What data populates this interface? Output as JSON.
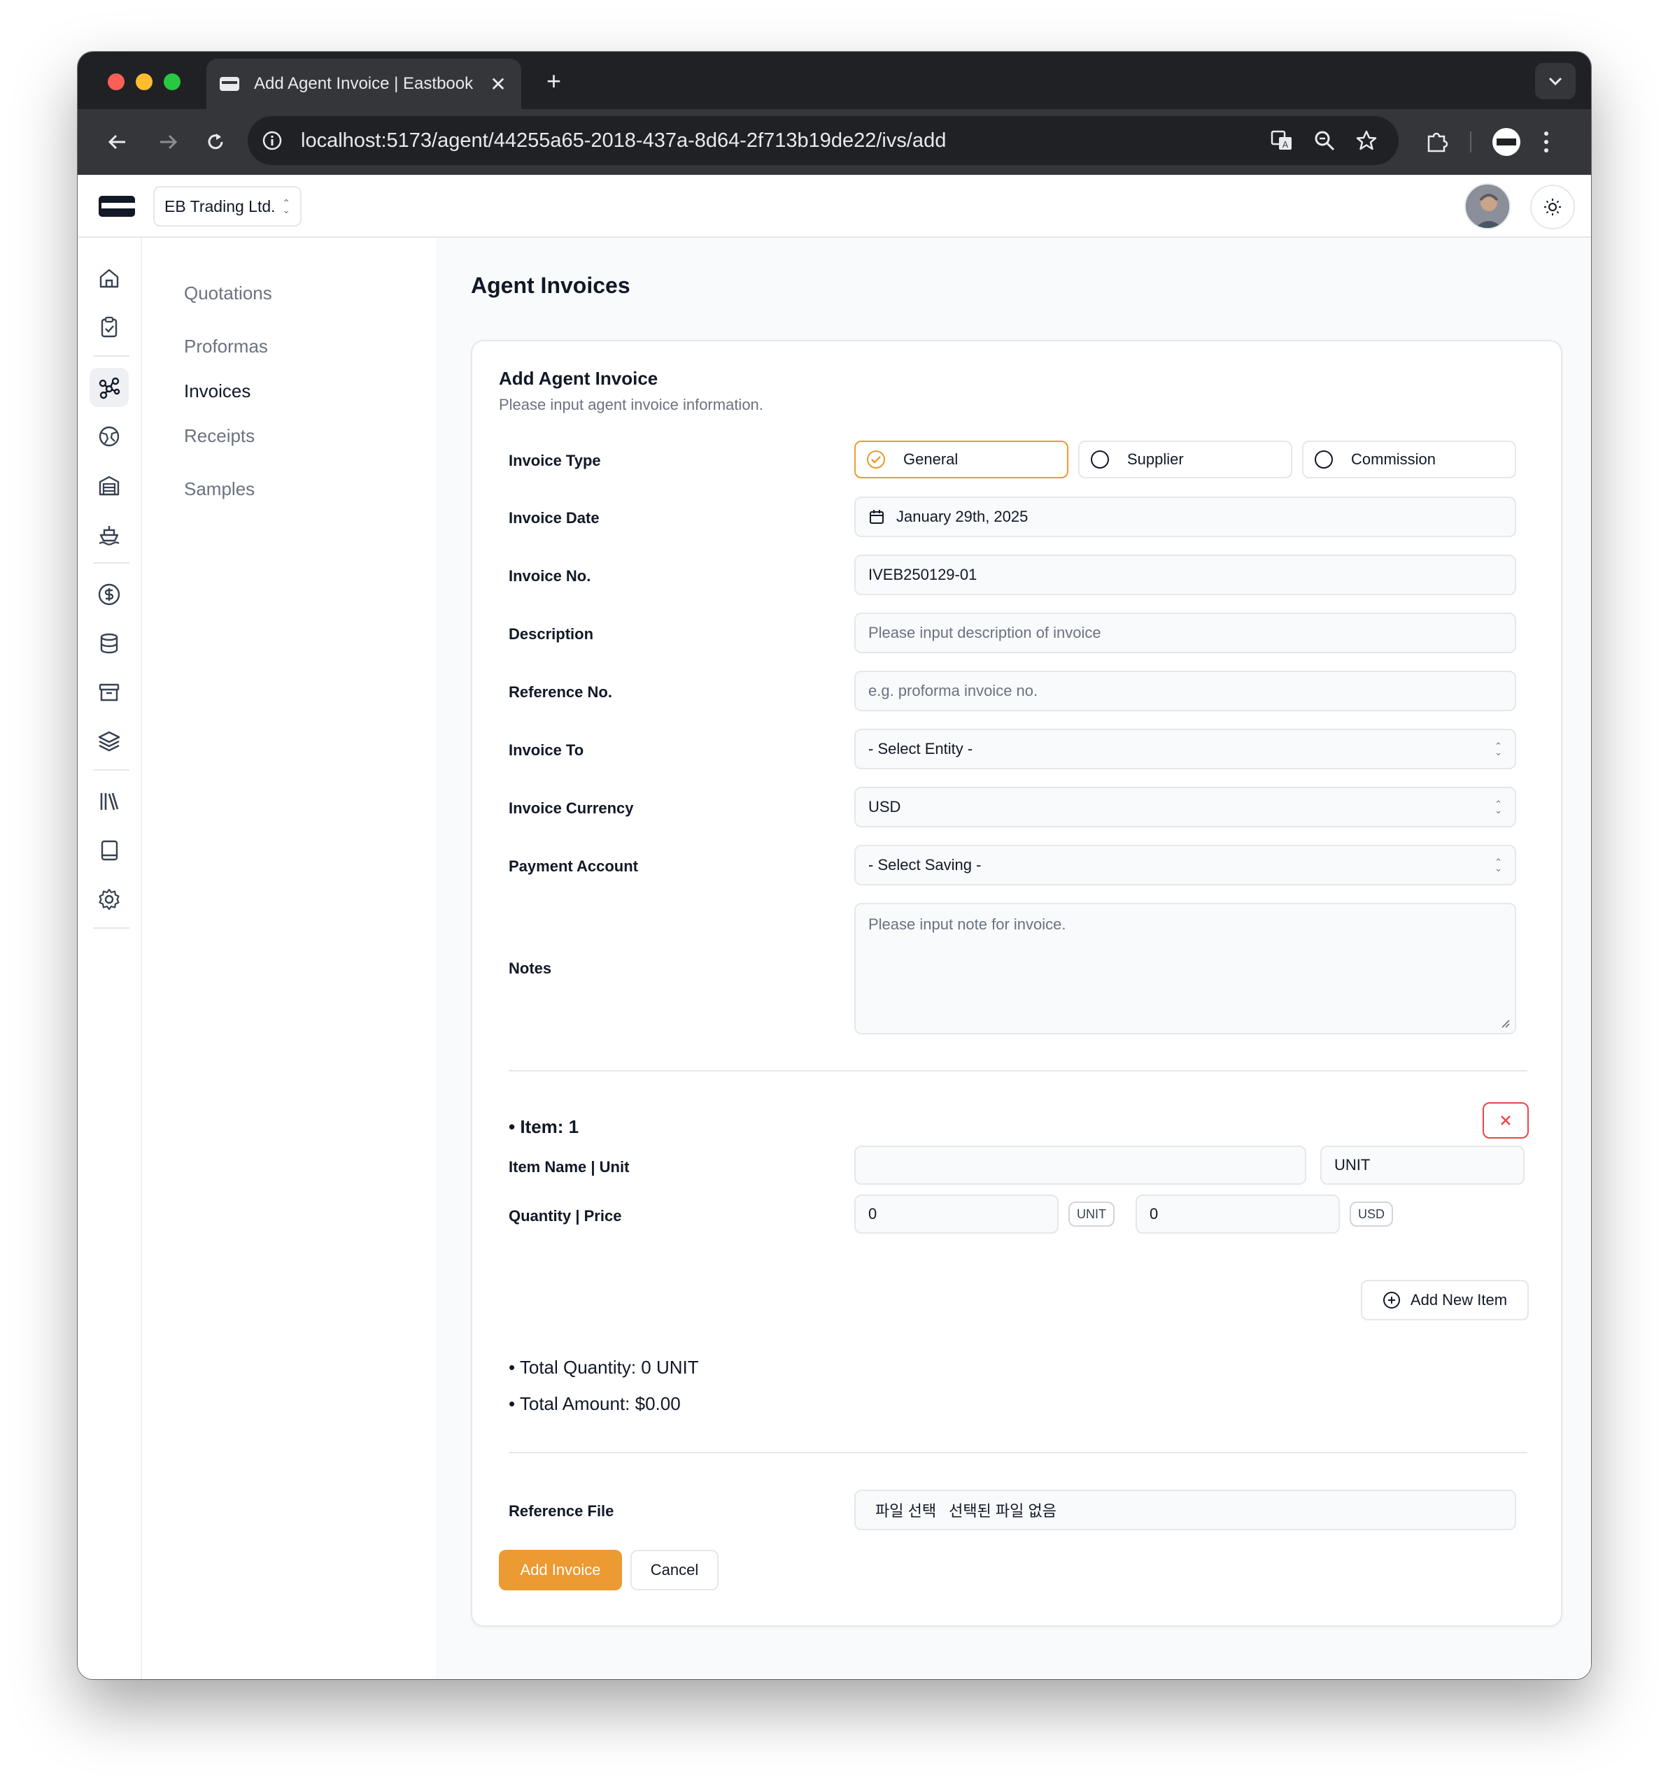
{
  "browser": {
    "tab_title": "Add Agent Invoice | Eastbook",
    "url": "localhost:5173/agent/44255a65-2018-437a-8d64-2f713b19de22/ivs/add"
  },
  "header": {
    "company": "EB Trading Ltd."
  },
  "subnav": {
    "items": [
      {
        "label": "Quotations"
      },
      {
        "label": "Proformas"
      },
      {
        "label": "Invoices"
      },
      {
        "label": "Receipts"
      },
      {
        "label": "Samples"
      }
    ]
  },
  "page": {
    "title": "Agent Invoices"
  },
  "form": {
    "title": "Add Agent Invoice",
    "description": "Please input agent invoice information.",
    "labels": {
      "invoice_type": "Invoice Type",
      "invoice_date": "Invoice Date",
      "invoice_no": "Invoice No.",
      "description": "Description",
      "reference_no": "Reference No.",
      "invoice_to": "Invoice To",
      "invoice_currency": "Invoice Currency",
      "payment_account": "Payment Account",
      "notes": "Notes",
      "reference_file": "Reference File"
    },
    "invoice_types": [
      "General",
      "Supplier",
      "Commission"
    ],
    "selected_type": "General",
    "invoice_date": "January 29th, 2025",
    "invoice_no": "IVEB250129-01",
    "description_placeholder": "Please input description of invoice",
    "reference_placeholder": "e.g. proforma invoice no.",
    "invoice_to": "- Select Entity -",
    "currency": "USD",
    "payment_account": "- Select Saving -",
    "notes_placeholder": "Please input note for invoice.",
    "item": {
      "title": "• Item: 1",
      "name_unit_label": "Item Name | Unit",
      "qty_price_label": "Quantity | Price",
      "name_value": "",
      "unit_value": "UNIT",
      "quantity": "0",
      "quantity_unit": "UNIT",
      "price": "0",
      "price_currency": "USD"
    },
    "add_item_label": "Add New Item",
    "total_quantity": "• Total Quantity:  0 UNIT",
    "total_amount": "• Total Amount: $0.00",
    "file_button": "파일 선택",
    "file_status": "선택된 파일 없음",
    "submit_label": "Add Invoice",
    "cancel_label": "Cancel"
  },
  "colors": {
    "accent": "#ec9a32",
    "danger": "#ef4444"
  }
}
